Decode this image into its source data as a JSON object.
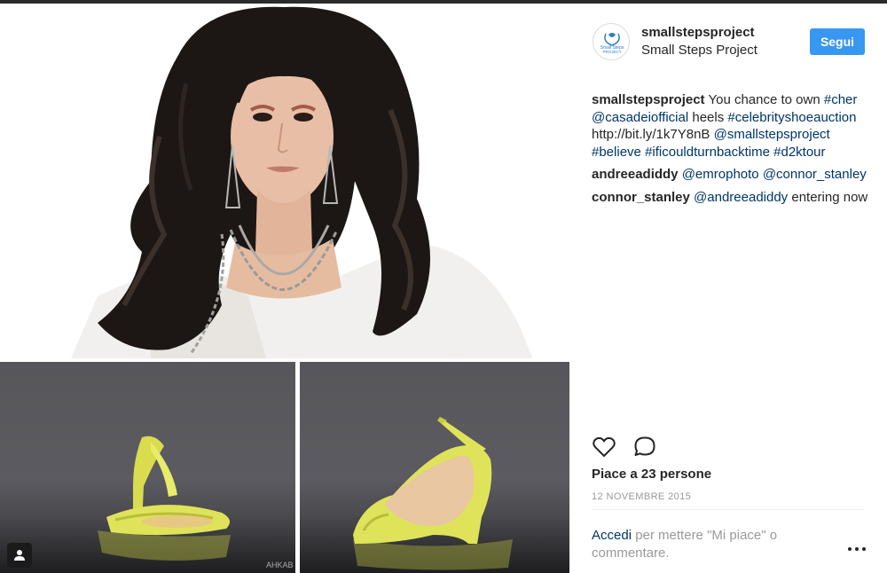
{
  "post": {
    "account": {
      "username": "smallstepsproject",
      "full_name": "Small Steps Project",
      "avatar_text_line1": "Small Steps",
      "avatar_text_line2": "PROJECT"
    },
    "follow_label": "Segui",
    "comments": [
      {
        "author": "smallstepsproject",
        "parts": [
          {
            "type": "text",
            "value": "You chance to own"
          },
          {
            "type": "tag",
            "value": "#cher"
          },
          {
            "type": "tag",
            "value": "@casadeiofficial"
          },
          {
            "type": "text",
            "value": "heels"
          },
          {
            "type": "tag",
            "value": "#celebrityshoeauction"
          },
          {
            "type": "text",
            "value": "http://bit.ly/1k7Y8nB"
          },
          {
            "type": "tag",
            "value": "@smallstepsproject"
          },
          {
            "type": "tag",
            "value": "#believe"
          },
          {
            "type": "tag",
            "value": "#ificouldturnbacktime"
          },
          {
            "type": "tag",
            "value": "#d2ktour"
          }
        ]
      },
      {
        "author": "andreeadiddy",
        "parts": [
          {
            "type": "tag",
            "value": "@emrophoto"
          },
          {
            "type": "tag",
            "value": "@connor_stanley"
          }
        ]
      },
      {
        "author": "connor_stanley",
        "parts": [
          {
            "type": "tag",
            "value": "@andreeadiddy"
          },
          {
            "type": "text",
            "value": "entering now"
          }
        ]
      }
    ],
    "likes_text": "Piace a 23 persone",
    "date": "12 NOVEMBRE 2015",
    "login_link": "Accedi",
    "login_rest": "per mettere \"Mi piace\" o commentare.",
    "icons": {
      "like": "heart-icon",
      "comment": "comment-icon",
      "more": "more-options-icon",
      "user_tag": "person-icon"
    },
    "image_watermark": "AHKAB",
    "colors": {
      "follow_button": "#3897f0",
      "link": "#003569",
      "shoe": "#dfe35a",
      "muted_text": "#999999"
    }
  }
}
